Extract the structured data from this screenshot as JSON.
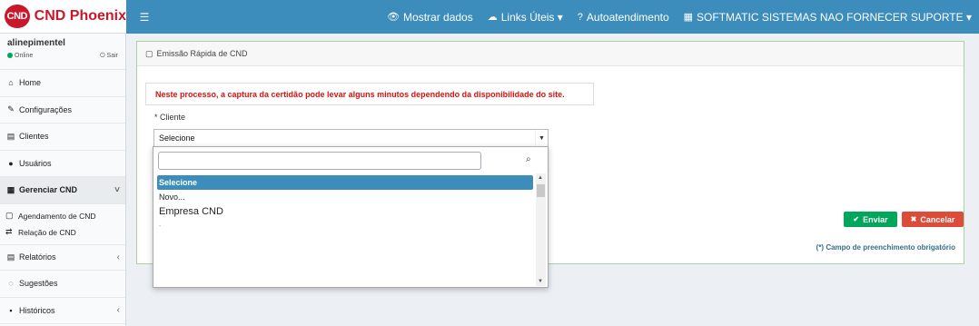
{
  "header": {
    "logo_badge": "CND",
    "logo_text": "CND Phoenix",
    "toggle_icon": "☰",
    "nav": [
      {
        "label": "Mostrar dados",
        "icon": "eye-icon",
        "glyph": "👁"
      },
      {
        "label": "Links Úteis ▾",
        "icon": "cloud-icon",
        "glyph": "☁"
      },
      {
        "label": "Autoatendimento",
        "icon": "help-icon",
        "glyph": "?"
      },
      {
        "label": "SOFTMATIC SISTEMAS NAO FORNECER SUPORTE ▾",
        "icon": "building-icon",
        "glyph": "▦"
      }
    ]
  },
  "sidebar": {
    "user_name": "alinepimentel",
    "status": "Online",
    "logout": "Sair",
    "items": [
      {
        "label": "Home",
        "icon": "home-icon",
        "glyph": "⌂"
      },
      {
        "label": "Configurações",
        "icon": "wrench-icon",
        "glyph": "✎"
      },
      {
        "label": "Clientes",
        "icon": "building-icon",
        "glyph": "▤"
      },
      {
        "label": "Usuários",
        "icon": "user-icon",
        "glyph": "●"
      },
      {
        "label": "Gerenciar CND",
        "icon": "calendar-icon",
        "glyph": "▦",
        "chevron": "˅"
      },
      {
        "label": "Relatórios",
        "icon": "report-icon",
        "glyph": "▤",
        "chevron": "‹"
      },
      {
        "label": "Sugestões",
        "icon": "comments-icon",
        "glyph": "◌"
      },
      {
        "label": "Históricos",
        "icon": "archive-icon",
        "glyph": "▪",
        "chevron": "‹"
      }
    ],
    "submenu": [
      {
        "label": "Agendamento de CND",
        "icon": "calendar-icon",
        "glyph": "▢"
      },
      {
        "label": "Relação de CND",
        "icon": "exchange-icon",
        "glyph": "⇄"
      }
    ]
  },
  "main": {
    "box_title": "Emissão Rápida de CND",
    "alert": "Neste processo, a captura da certidão pode levar alguns minutos dependendo da disponibilidade do site.",
    "field_label": "* Cliente",
    "select_value": "Selecione",
    "send_label": "Enviar",
    "cancel_label": "Cancelar",
    "required_note": "(*) Campo de preenchimento obrigatório"
  },
  "dropdown": {
    "search_value": "",
    "options": [
      "Selecione",
      "Novo...",
      "Empresa CND",
      "-"
    ]
  },
  "colors": {
    "brand": "#c9182b",
    "navbar": "#3c8dbc",
    "send": "#00a65a",
    "cancel": "#dd4b39",
    "alert_text": "#dd1111"
  }
}
